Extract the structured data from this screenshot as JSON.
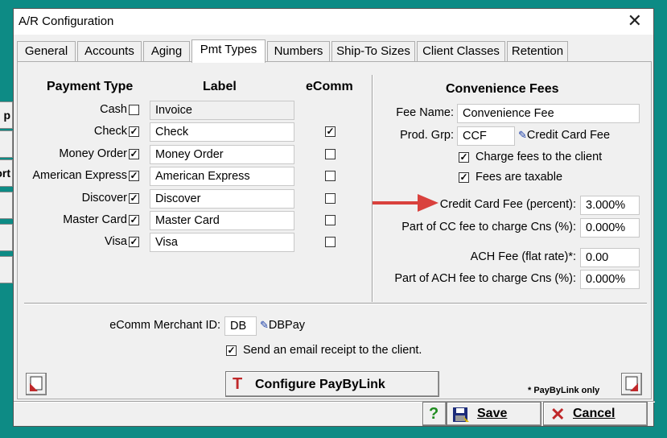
{
  "window": {
    "title": "A/R Configuration",
    "close_glyph": "✕"
  },
  "background_buttons": [
    {
      "label": "p"
    },
    {
      "label": ""
    },
    {
      "label": "ort"
    },
    {
      "label": ""
    },
    {
      "label": ""
    },
    {
      "label": ""
    }
  ],
  "tabs": [
    {
      "label": "General"
    },
    {
      "label": "Accounts"
    },
    {
      "label": "Aging"
    },
    {
      "label": "Pmt Types",
      "active": true
    },
    {
      "label": "Numbers"
    },
    {
      "label": "Ship-To Sizes"
    },
    {
      "label": "Client Classes"
    },
    {
      "label": "Retention"
    }
  ],
  "payment_types": {
    "header_type": "Payment Type",
    "header_label": "Label",
    "header_ecomm": "eComm",
    "rows": [
      {
        "type": "Cash",
        "enabled": false,
        "label": "Invoice",
        "readonly": true,
        "ecomm": null
      },
      {
        "type": "Check",
        "enabled": true,
        "label": "Check",
        "readonly": false,
        "ecomm": true
      },
      {
        "type": "Money Order",
        "enabled": true,
        "label": "Money Order",
        "readonly": false,
        "ecomm": false
      },
      {
        "type": "American Express",
        "enabled": true,
        "label": "American Express",
        "readonly": false,
        "ecomm": false
      },
      {
        "type": "Discover",
        "enabled": true,
        "label": "Discover",
        "readonly": false,
        "ecomm": false
      },
      {
        "type": "Master Card",
        "enabled": true,
        "label": "Master Card",
        "readonly": false,
        "ecomm": false
      },
      {
        "type": "Visa",
        "enabled": true,
        "label": "Visa",
        "readonly": false,
        "ecomm": false
      }
    ]
  },
  "fees": {
    "header": "Convenience Fees",
    "fee_name_label": "Fee Name:",
    "fee_name_value": "Convenience Fee",
    "prod_grp_label": "Prod. Grp:",
    "prod_grp_value": "CCF",
    "prod_grp_link": "Credit Card Fee",
    "charge_fees_label": "Charge fees to the client",
    "charge_fees_checked": true,
    "taxable_label": "Fees are taxable",
    "taxable_checked": true,
    "cc_fee_label": "Credit Card Fee (percent):",
    "cc_fee_value": "3.000%",
    "cc_part_label": "Part of CC fee to charge Cns (%):",
    "cc_part_value": "0.000%",
    "ach_fee_label": "ACH Fee (flat rate)*:",
    "ach_fee_value": "0.00",
    "ach_part_label": "Part of ACH fee to charge Cns (%):",
    "ach_part_value": "0.000%",
    "arrow_color": "#d9413d"
  },
  "ecomm": {
    "merchant_label": "eComm Merchant ID:",
    "merchant_value": "DB",
    "merchant_link": "DBPay",
    "email_receipt_label": "Send an email receipt to the client.",
    "email_receipt_checked": true
  },
  "paybylink": {
    "button_label": "Configure PayByLink",
    "note": "* PayByLink only"
  },
  "footer": {
    "help_glyph": "?",
    "save_label": "Save",
    "cancel_label": "Cancel"
  },
  "glyphs": {
    "check": "✓",
    "pencil": "✎"
  }
}
